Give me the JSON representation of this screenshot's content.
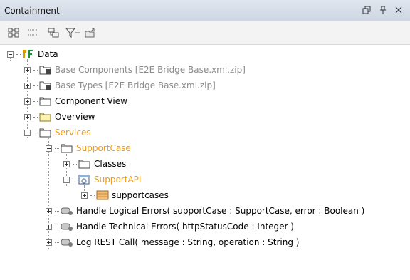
{
  "panel": {
    "title": "Containment"
  },
  "tree": {
    "root": {
      "label": "Data"
    },
    "items": [
      {
        "label": "Base Components [E2E Bridge Base.xml.zip]"
      },
      {
        "label": "Base Types [E2E Bridge Base.xml.zip]"
      },
      {
        "label": "Component View"
      },
      {
        "label": "Overview"
      },
      {
        "label": "Services"
      },
      {
        "label": "SupportCase"
      },
      {
        "label": "Classes"
      },
      {
        "label": "SupportAPI"
      },
      {
        "label": "supportcases"
      },
      {
        "label": "Handle Logical Errors( supportCase : SupportCase, error : Boolean )"
      },
      {
        "label": "Handle Technical Errors( httpStatusCode : Integer )"
      },
      {
        "label": "Log REST Call( message : String, operation : String )"
      }
    ]
  },
  "colors": {
    "greyed": "#8a8a8a",
    "highlight": "#f39c12",
    "folder": "#5a5a5a"
  }
}
